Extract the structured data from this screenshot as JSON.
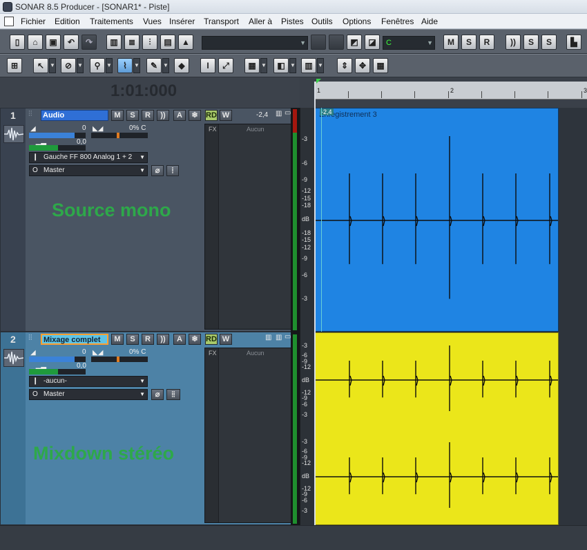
{
  "window": {
    "title": "SONAR 8.5 Producer - [SONAR1* - Piste]"
  },
  "menu": [
    "Fichier",
    "Edition",
    "Traitements",
    "Vues",
    "Insérer",
    "Transport",
    "Aller à",
    "Pistes",
    "Outils",
    "Options",
    "Fenêtres",
    "Aide"
  ],
  "toolbar": {
    "snap_value": "C"
  },
  "now_time": "1:01:000",
  "ruler": {
    "labels": [
      "1",
      "2",
      "3"
    ]
  },
  "tracks": [
    {
      "number": "1",
      "name": "Audio",
      "buttons": [
        "M",
        "S",
        "R",
        "A",
        "RD",
        "W"
      ],
      "volume": "0",
      "pan": "0% C",
      "trim": "0,0",
      "peak": "-2,4",
      "input": "Gauche FF 800 Analog 1 + 2",
      "output": "Master",
      "fx_label": "FX",
      "fx_value": "Aucun",
      "overlay_text": "Source mono"
    },
    {
      "number": "2",
      "name": "Mixage complet",
      "buttons": [
        "M",
        "S",
        "R",
        "A",
        "RD",
        "W"
      ],
      "volume": "0",
      "pan": "0% C",
      "trim": "0,0",
      "input": "-aucun-",
      "output": "Master",
      "fx_label": "FX",
      "fx_value": "Aucun",
      "overlay_text": "Mixdown stéréo"
    }
  ],
  "clips": [
    {
      "label": "Enregistrement 3",
      "tag": "-2,4",
      "color": "#1f84e3"
    },
    {
      "color": "#ebe61a"
    }
  ],
  "db_scale_track1": [
    "-3",
    "-6",
    "-9",
    "-12",
    "-15",
    "-18",
    "dB",
    "-18",
    "-15",
    "-12",
    "-9",
    "-6",
    "-3"
  ],
  "db_scale_track2": [
    "-3",
    "-6",
    "-9",
    "-12",
    "dB",
    "-12",
    "-9",
    "-6",
    "-3"
  ],
  "colors": {
    "meter_green": "#1f8f2e",
    "meter_red": "#a5170e",
    "overlay_text": "#2ea84a"
  }
}
